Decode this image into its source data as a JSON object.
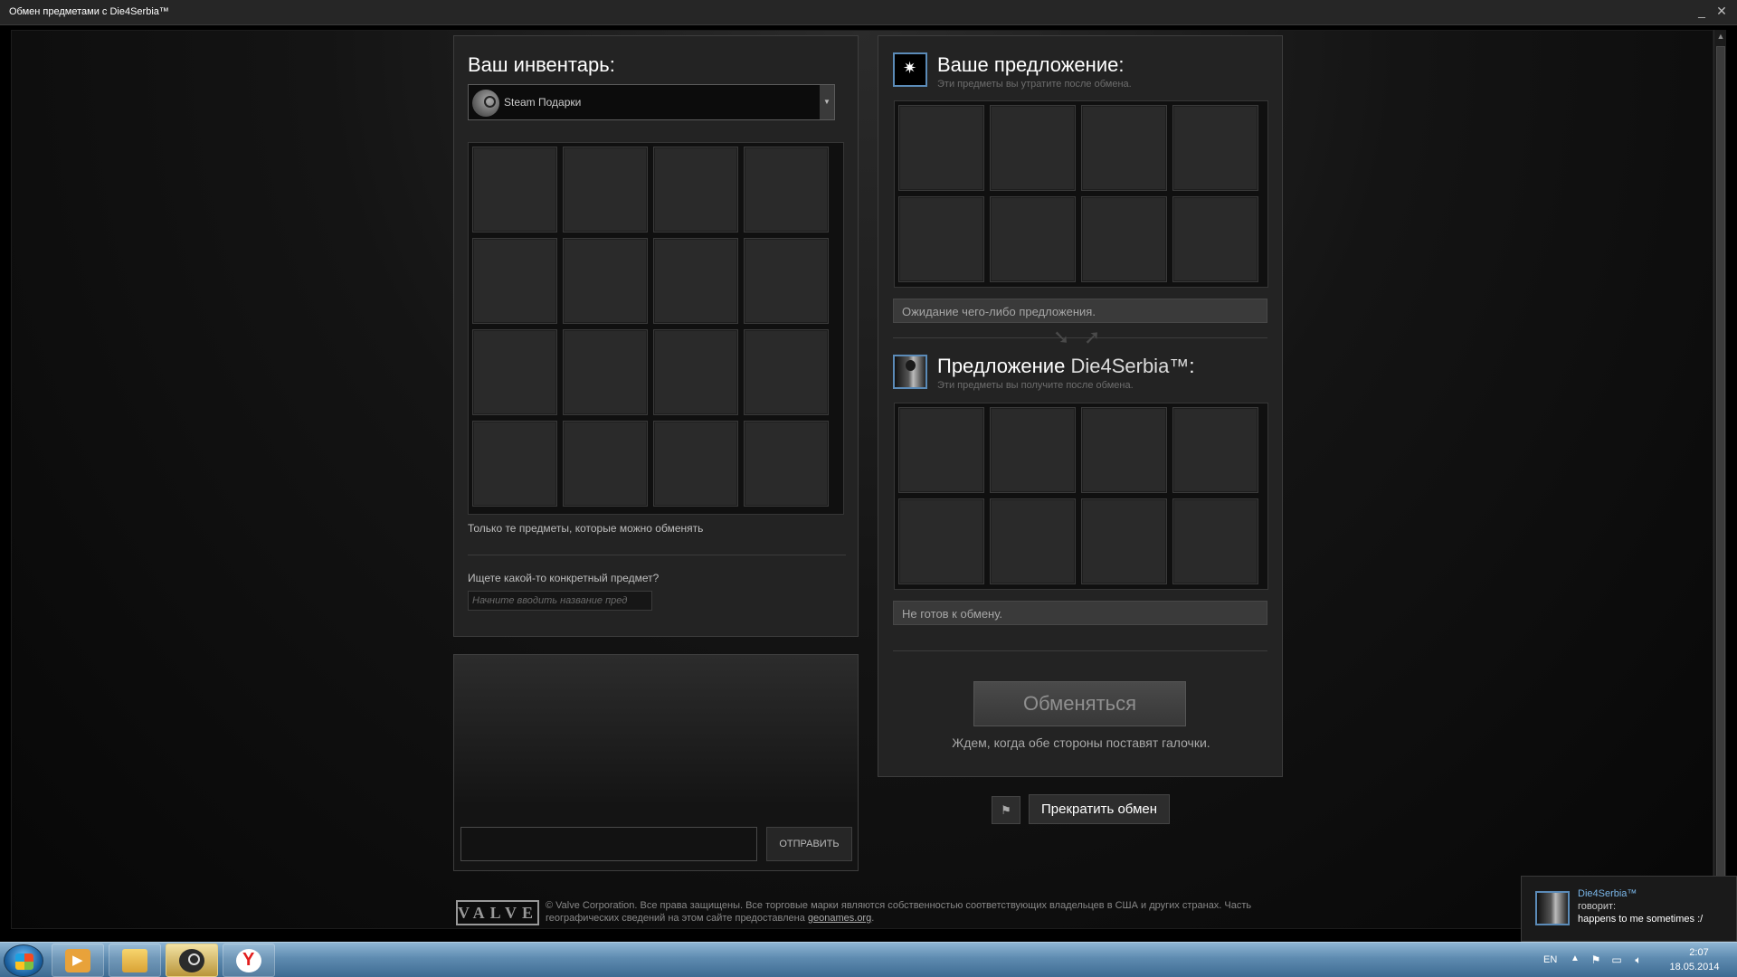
{
  "window": {
    "title": "Обмен предметами с Die4Serbia™",
    "minimize": "_",
    "close": "✕"
  },
  "inventory": {
    "title": "Ваш инвентарь:",
    "dropdown_value": "Steam Подарки",
    "tradable_note": "Только те предметы, которые можно обменять",
    "search_label": "Ищете какой-то конкретный предмет?",
    "search_placeholder": "Начните вводить название пред"
  },
  "chat": {
    "send_label": "ОТПРАВИТЬ"
  },
  "your_offer": {
    "title": "Ваше предложение:",
    "subtitle": "Эти предметы вы утратите после обмена.",
    "status": "Ожидание чего-либо предложения."
  },
  "their_offer": {
    "title_prefix": "Предложение",
    "partner_name": "Die4Serbia™",
    "title_suffix": ":",
    "subtitle": "Эти предметы вы получите после обмена.",
    "status": "Не готов к обмену."
  },
  "trade": {
    "button_label": "Обменяться",
    "hint": "Ждем, когда обе стороны поставят галочки.",
    "cancel_label": "Прекратить обмен"
  },
  "footer": {
    "valve": "VALVE",
    "text": "© Valve Corporation. Все права защищены. Все торговые марки являются собственностью соответствующих владельцев в США и других странах. Часть географических сведений на этом сайте предоставлена",
    "link": "geonames.org",
    "text_end": "."
  },
  "notification": {
    "name": "Die4Serbia™",
    "says": "говорит:",
    "message": "happens to me sometimes :/"
  },
  "taskbar": {
    "language": "EN",
    "time": "2:07",
    "date": "18.05.2014"
  },
  "icons": {
    "arrow_down": "➘",
    "arrow_up": "➚",
    "flag": "⚑"
  },
  "colors": {
    "accent_blue": "#5b8bb8",
    "name_blue": "#7ab6e8"
  }
}
